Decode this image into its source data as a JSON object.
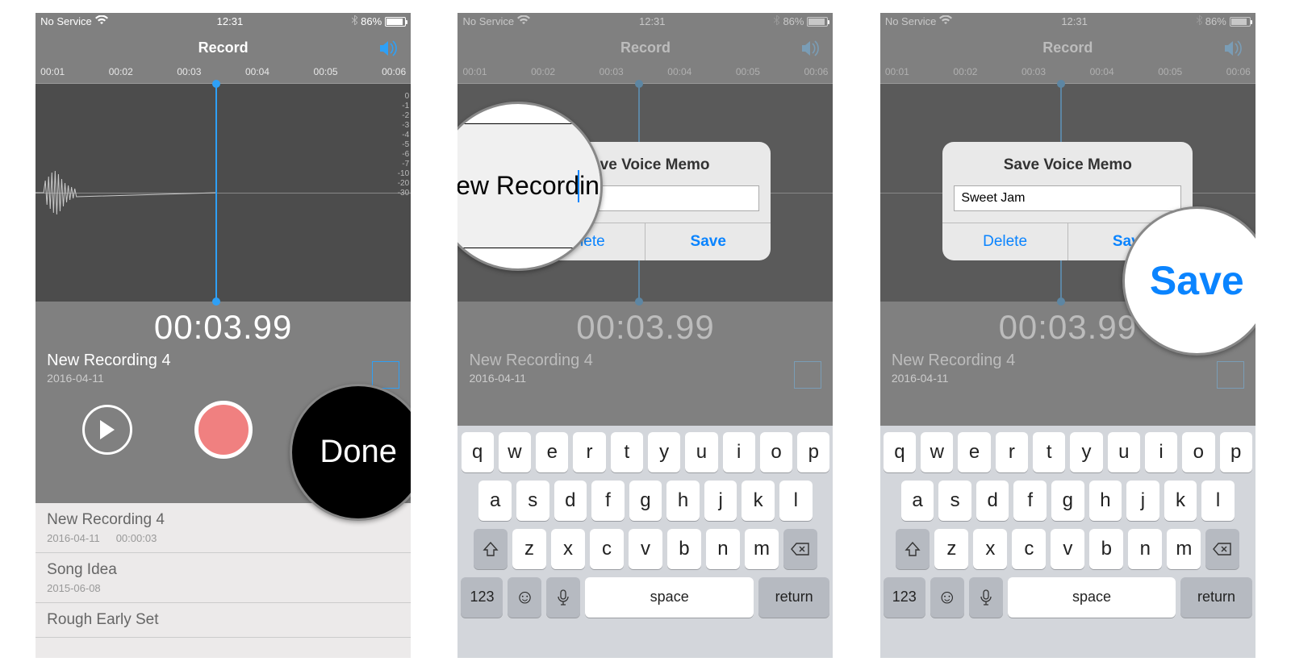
{
  "status": {
    "carrier": "No Service",
    "time": "12:31",
    "battery_pct": "86%"
  },
  "title": "Record",
  "ruler": [
    "00:01",
    "00:02",
    "00:03",
    "00:04",
    "00:05",
    "00:06"
  ],
  "timer": "00:03.99",
  "recording": {
    "name": "New Recording 4",
    "date": "2016-04-11"
  },
  "controls": {
    "done": "Done"
  },
  "list": [
    {
      "name": "New Recording 4",
      "date": "2016-04-11",
      "dur": "00:00:03"
    },
    {
      "name": "Song Idea",
      "date": "2015-06-08",
      "dur": ""
    },
    {
      "name": "Rough Early Set",
      "date": "",
      "dur": ""
    }
  ],
  "dialog": {
    "title": "Save Voice Memo",
    "input_p2": "",
    "input_p3": "Sweet Jam",
    "delete": "Delete",
    "save": "Save"
  },
  "keyboard": {
    "r1": [
      "q",
      "w",
      "e",
      "r",
      "t",
      "y",
      "u",
      "i",
      "o",
      "p"
    ],
    "r2": [
      "a",
      "s",
      "d",
      "f",
      "g",
      "h",
      "j",
      "k",
      "l"
    ],
    "r3": [
      "z",
      "x",
      "c",
      "v",
      "b",
      "n",
      "m"
    ],
    "num": "123",
    "space": "space",
    "ret": "return"
  },
  "callouts": {
    "done": "Done",
    "new_rec": "New Recordin",
    "save": "Save"
  },
  "db_scale": [
    "0",
    "-1",
    "-2",
    "-3",
    "-4",
    "-5",
    "-6",
    "-7",
    "-10",
    "-20",
    "-30"
  ]
}
